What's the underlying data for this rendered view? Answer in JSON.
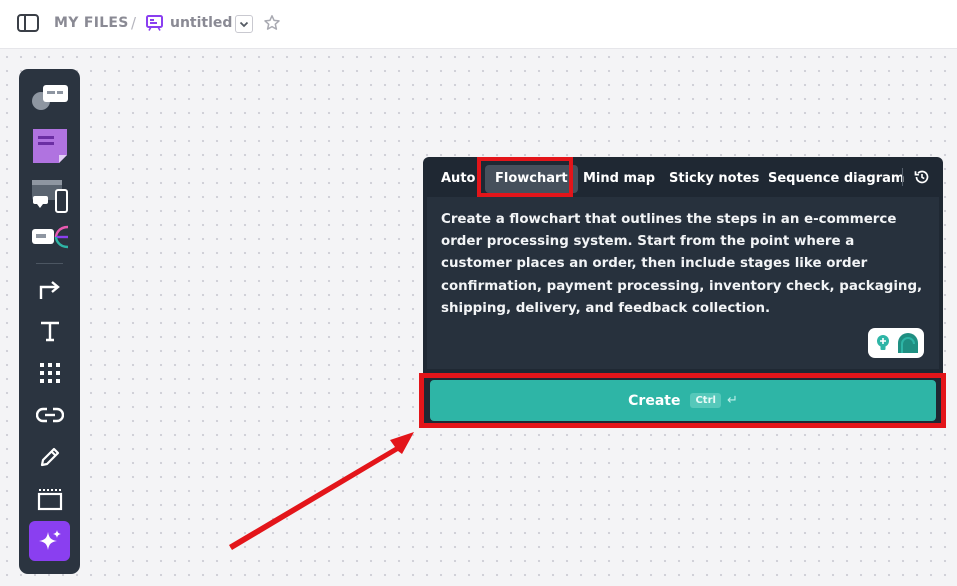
{
  "breadcrumb": {
    "root": "MY FILES",
    "separator": "/",
    "title": "untitled"
  },
  "icons": {
    "sidebar_toggle": "sidebar-toggle-icon",
    "board": "board-icon",
    "dropdown": "chevron-down-icon",
    "star": "star-icon",
    "history": "history-icon",
    "enter": "enter-icon"
  },
  "toolbar": {
    "tools": [
      "templates-tool",
      "sticky-note-tool",
      "devices-tool",
      "components-tool",
      "connector-tool",
      "text-tool",
      "grid-tool",
      "link-tool",
      "pen-tool",
      "frame-tool",
      "ai-assistant-tool"
    ]
  },
  "panel": {
    "tabs": [
      {
        "label": "Auto"
      },
      {
        "label": "Flowchart"
      },
      {
        "label": "Mind map"
      },
      {
        "label": "Sticky notes"
      },
      {
        "label": "Sequence diagram"
      }
    ],
    "selected_tab": "Flowchart",
    "prompt": "Create a flowchart that outlines the steps in an e-commerce order processing system. Start from the point where a customer places an order, then include stages like order confirmation, payment processing, inventory check, packaging, shipping, delivery, and feedback collection.",
    "create_label": "Create",
    "shortcut_key": "Ctrl",
    "enter_glyph": "↵"
  },
  "colors": {
    "accent": "#2eb5a6",
    "panel_bg": "#1f2833",
    "toolbar_bg": "#2b3440",
    "highlight": "#e3151a",
    "ai_purple": "#8a3ff0"
  }
}
